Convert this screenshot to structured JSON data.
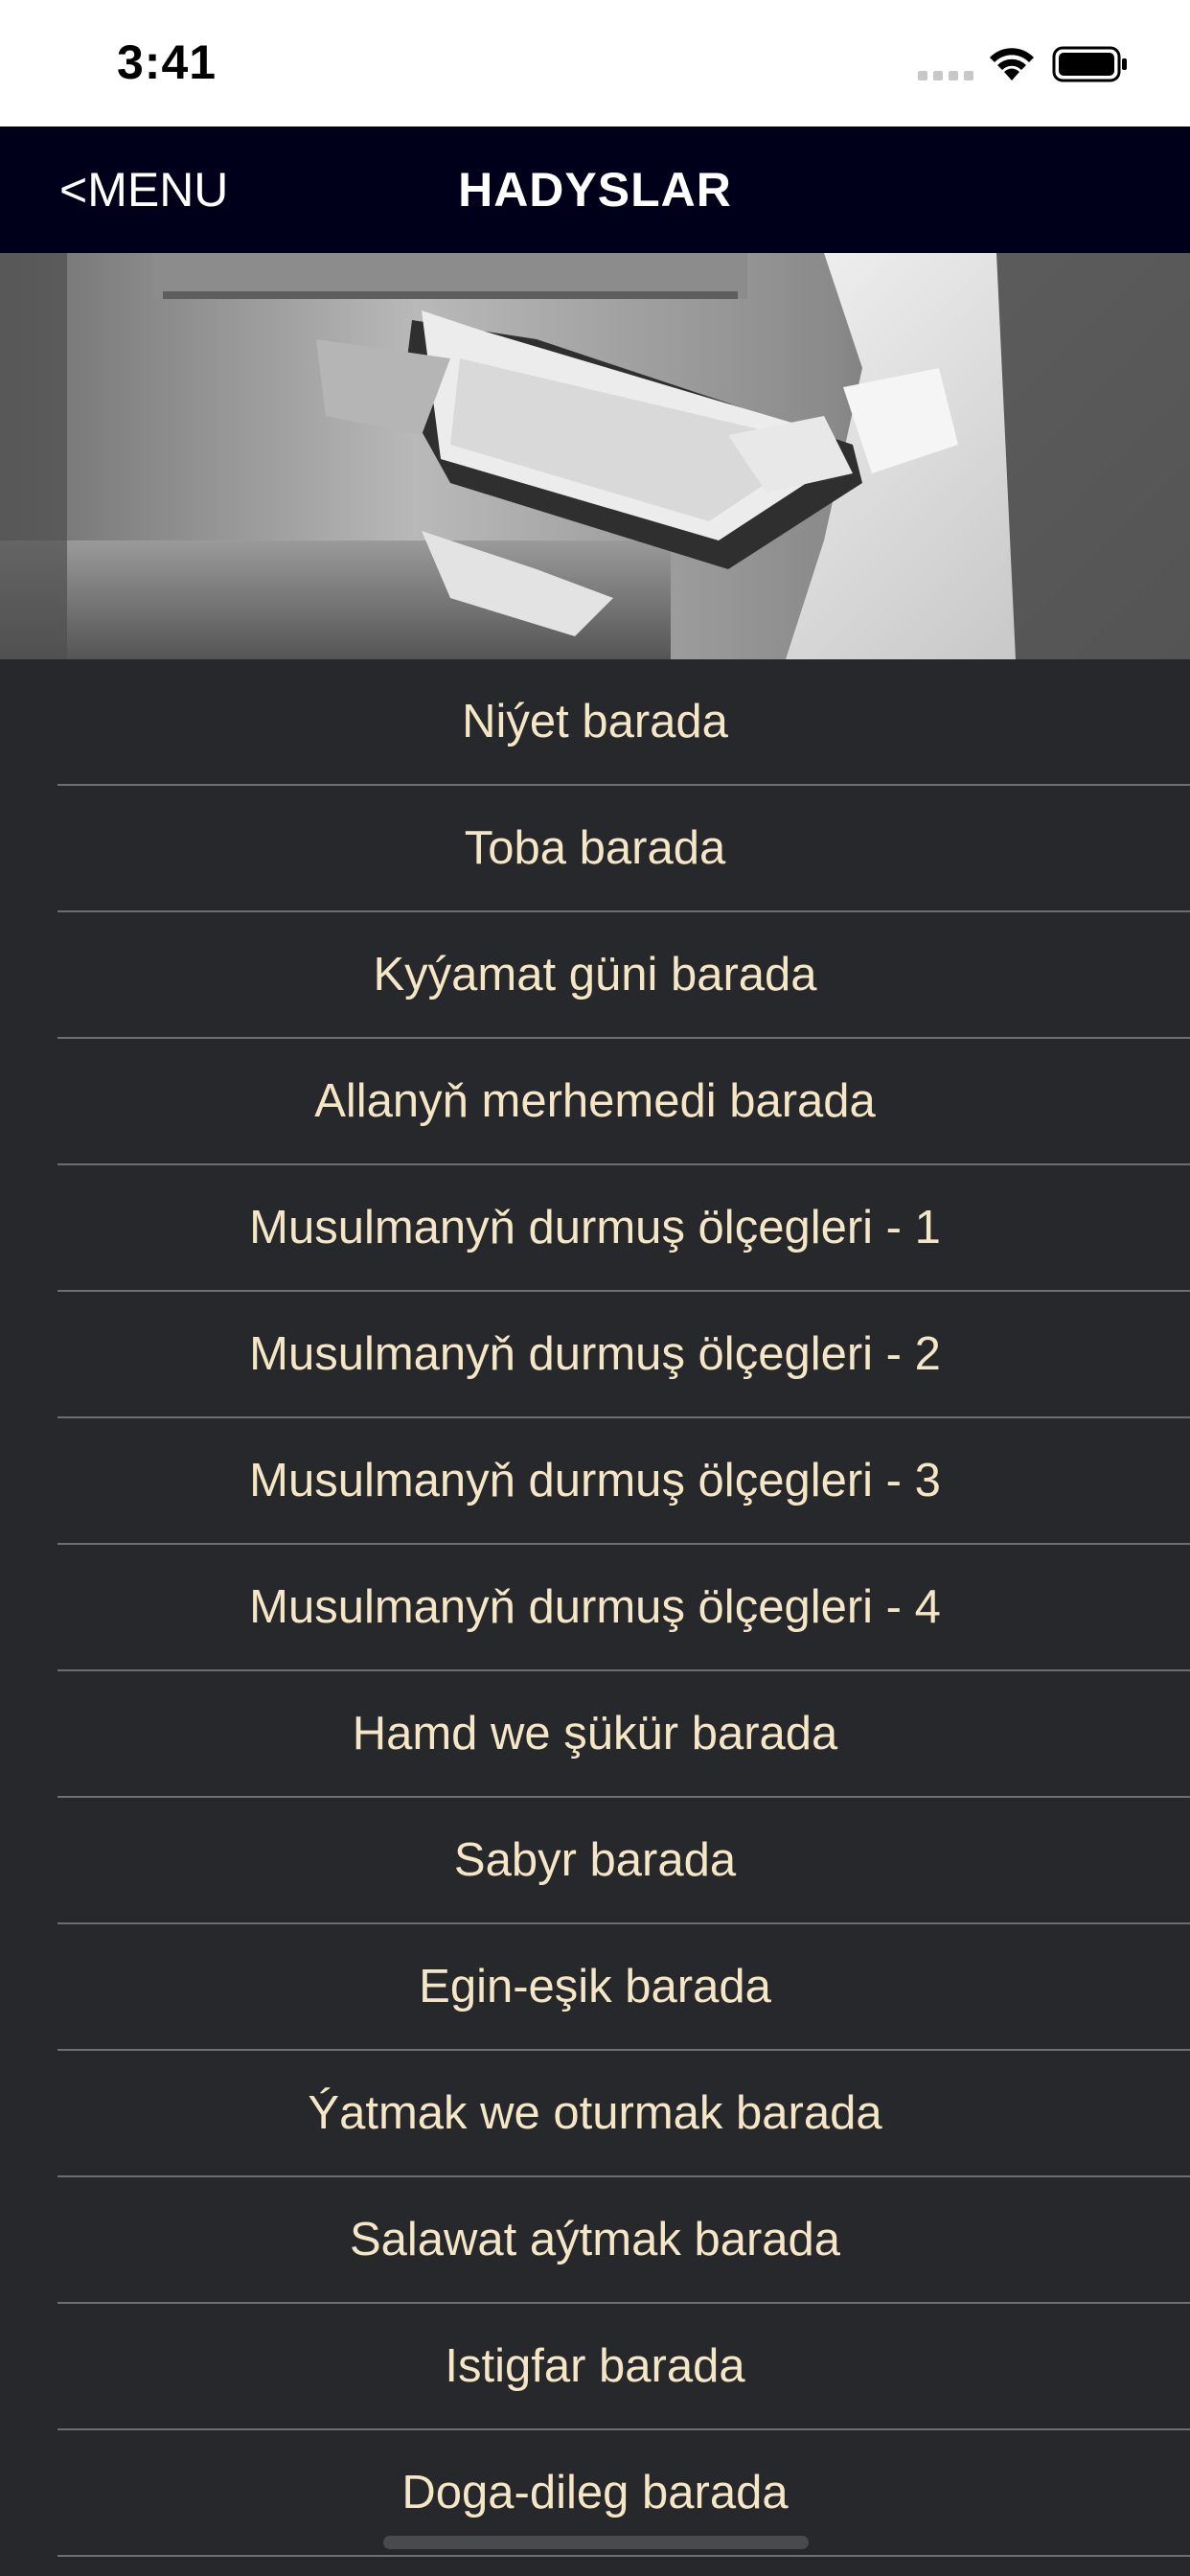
{
  "status_bar": {
    "time": "3:41",
    "icons": [
      "cellular-signal-icon",
      "wifi-icon",
      "battery-icon"
    ]
  },
  "nav": {
    "back_label": "<MENU",
    "title": "HADYSLAR"
  },
  "hero": {
    "icon": "person-reading-book-photo"
  },
  "list": {
    "items": [
      "Niýet barada",
      "Toba barada",
      "Kyýamat güni barada",
      "Allanyň merhemedi barada",
      "Musulmanyň durmuş ölçegleri - 1",
      "Musulmanyň durmuş ölçegleri - 2",
      "Musulmanyň durmuş ölçegleri - 3",
      "Musulmanyň durmuş ölçegleri - 4",
      "Hamd we şükür barada",
      "Sabyr barada",
      "Egin-eşik barada",
      "Ýatmak we oturmak barada",
      "Salawat aýtmak barada",
      "Istigfar barada",
      "Doga-dileg barada"
    ]
  },
  "colors": {
    "nav_background": "#00001a",
    "list_background": "#26282c",
    "item_text": "#f5e6c6",
    "separator": "#6f6f72"
  }
}
